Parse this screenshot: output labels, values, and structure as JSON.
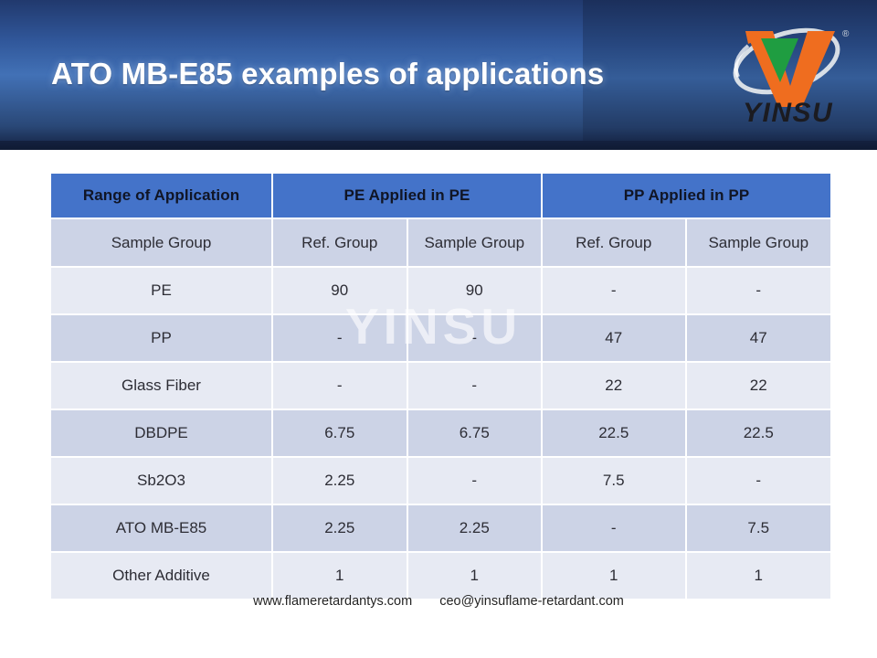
{
  "slide": {
    "title": "ATO MB-E85 examples of applications",
    "watermark": "YINSU",
    "header_accent": "#4473c9",
    "header_bg_dark": "#13203f",
    "header_bg_mid": "#3c68ab"
  },
  "logo": {
    "name": "yinsu-logo",
    "wordmark": "YINSU",
    "registered_mark": "®",
    "colors": {
      "orange": "#ef6d1f",
      "green": "#1f9d41",
      "swoosh": "#e8ecef",
      "text": "#231f20"
    }
  },
  "table": {
    "group_headers": [
      {
        "label": "Range of Application",
        "colspan": 1
      },
      {
        "label": "PE Applied in PE",
        "colspan": 2
      },
      {
        "label": "PP Applied in PP",
        "colspan": 2
      }
    ],
    "sub_headers": [
      "Sample Group",
      "Ref. Group",
      "Sample Group",
      "Ref. Group",
      "Sample Group"
    ],
    "rows": [
      {
        "name": "PE",
        "values": [
          "90",
          "90",
          "-",
          "-"
        ]
      },
      {
        "name": "PP",
        "values": [
          "-",
          "-",
          "47",
          "47"
        ]
      },
      {
        "name": "Glass Fiber",
        "values": [
          "-",
          "-",
          "22",
          "22"
        ]
      },
      {
        "name": "DBDPE",
        "values": [
          "6.75",
          "6.75",
          "22.5",
          "22.5"
        ]
      },
      {
        "name": "Sb2O3",
        "values": [
          "2.25",
          "-",
          "7.5",
          "-"
        ]
      },
      {
        "name": "ATO MB-E85",
        "values": [
          "2.25",
          "2.25",
          "-",
          "7.5"
        ]
      },
      {
        "name": "Other Additive",
        "values": [
          "1",
          "1",
          "1",
          "1"
        ]
      }
    ]
  },
  "footer": {
    "website": "www.flameretardantys.com",
    "email": "ceo@yinsuflame-retardant.com"
  }
}
